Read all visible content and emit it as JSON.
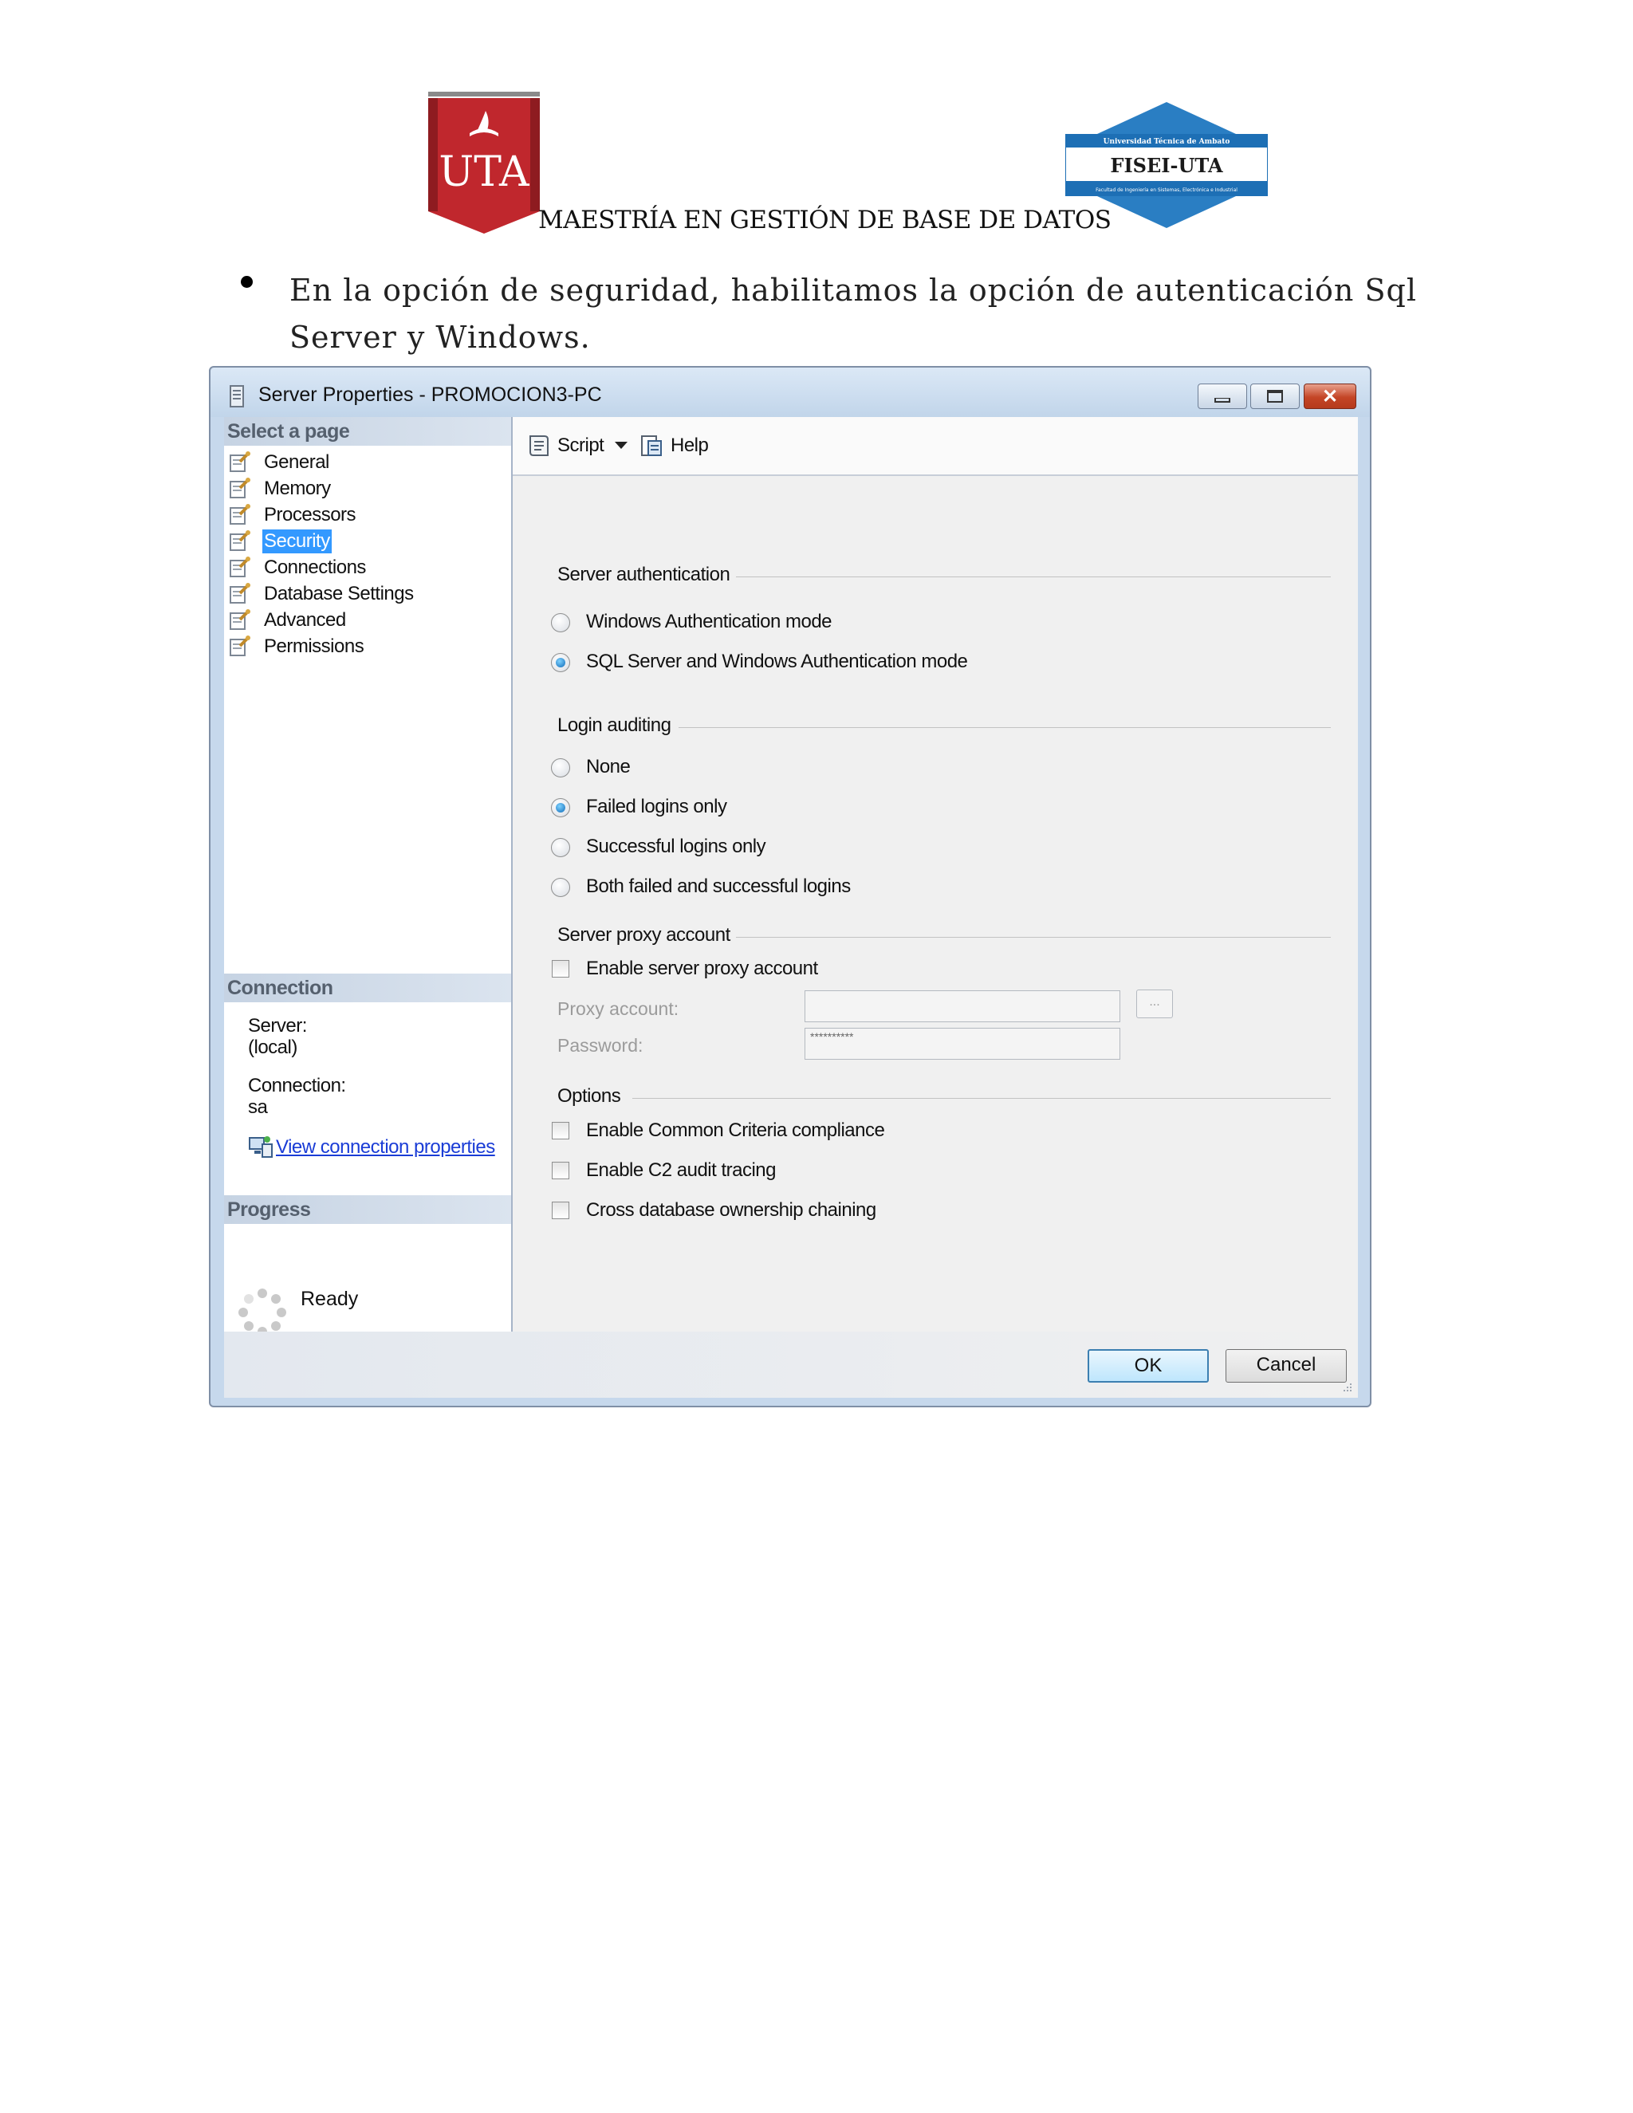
{
  "document": {
    "header_title": "MAESTRÍA EN GESTIÓN DE BASE DE DATOS",
    "logos": {
      "uta": "UTA",
      "fisei_top": "Universidad Técnica de Ambato",
      "fisei_main": "FISEI-UTA",
      "fisei_bottom": "Facultad de Ingeniería en Sistemas, Electrónica e Industrial"
    },
    "paragraph": "En la opción de seguridad, habilitamos la opción de autenticación Sql Server y Windows."
  },
  "dialog": {
    "title": "Server Properties - PROMOCION3-PC",
    "close_glyph": "✕",
    "select_page_header": "Select a page",
    "pages": [
      {
        "label": "General"
      },
      {
        "label": "Memory"
      },
      {
        "label": "Processors"
      },
      {
        "label": "Security"
      },
      {
        "label": "Connections"
      },
      {
        "label": "Database Settings"
      },
      {
        "label": "Advanced"
      },
      {
        "label": "Permissions"
      }
    ],
    "selected_page": "Security",
    "connection_header": "Connection",
    "server_label": "Server:",
    "server_value": "(local)",
    "connection_label": "Connection:",
    "connection_value": "sa",
    "view_connection_link": "View connection properties",
    "progress_header": "Progress",
    "progress_status": "Ready",
    "toolbar": {
      "script_label": "Script",
      "help_label": "Help"
    },
    "server_authentication": {
      "group_label": "Server authentication",
      "options": [
        {
          "label": "Windows Authentication mode",
          "checked": false
        },
        {
          "label": "SQL Server and Windows Authentication mode",
          "checked": true
        }
      ]
    },
    "login_auditing": {
      "group_label": "Login auditing",
      "options": [
        {
          "label": "None",
          "checked": false
        },
        {
          "label": "Failed logins only",
          "checked": true
        },
        {
          "label": "Successful logins only",
          "checked": false
        },
        {
          "label": "Both failed and successful logins",
          "checked": false
        }
      ]
    },
    "server_proxy": {
      "group_label": "Server proxy account",
      "enable_label": "Enable server proxy account",
      "enabled": false,
      "proxy_account_label": "Proxy account:",
      "proxy_account_value": "",
      "password_label": "Password:",
      "password_value": "**********",
      "browse_label": "..."
    },
    "options": {
      "group_label": "Options",
      "items": [
        {
          "label": "Enable Common Criteria compliance",
          "checked": false
        },
        {
          "label": "Enable C2 audit tracing",
          "checked": false
        },
        {
          "label": "Cross database ownership chaining",
          "checked": false
        }
      ]
    },
    "ok_label": "OK",
    "cancel_label": "Cancel"
  }
}
